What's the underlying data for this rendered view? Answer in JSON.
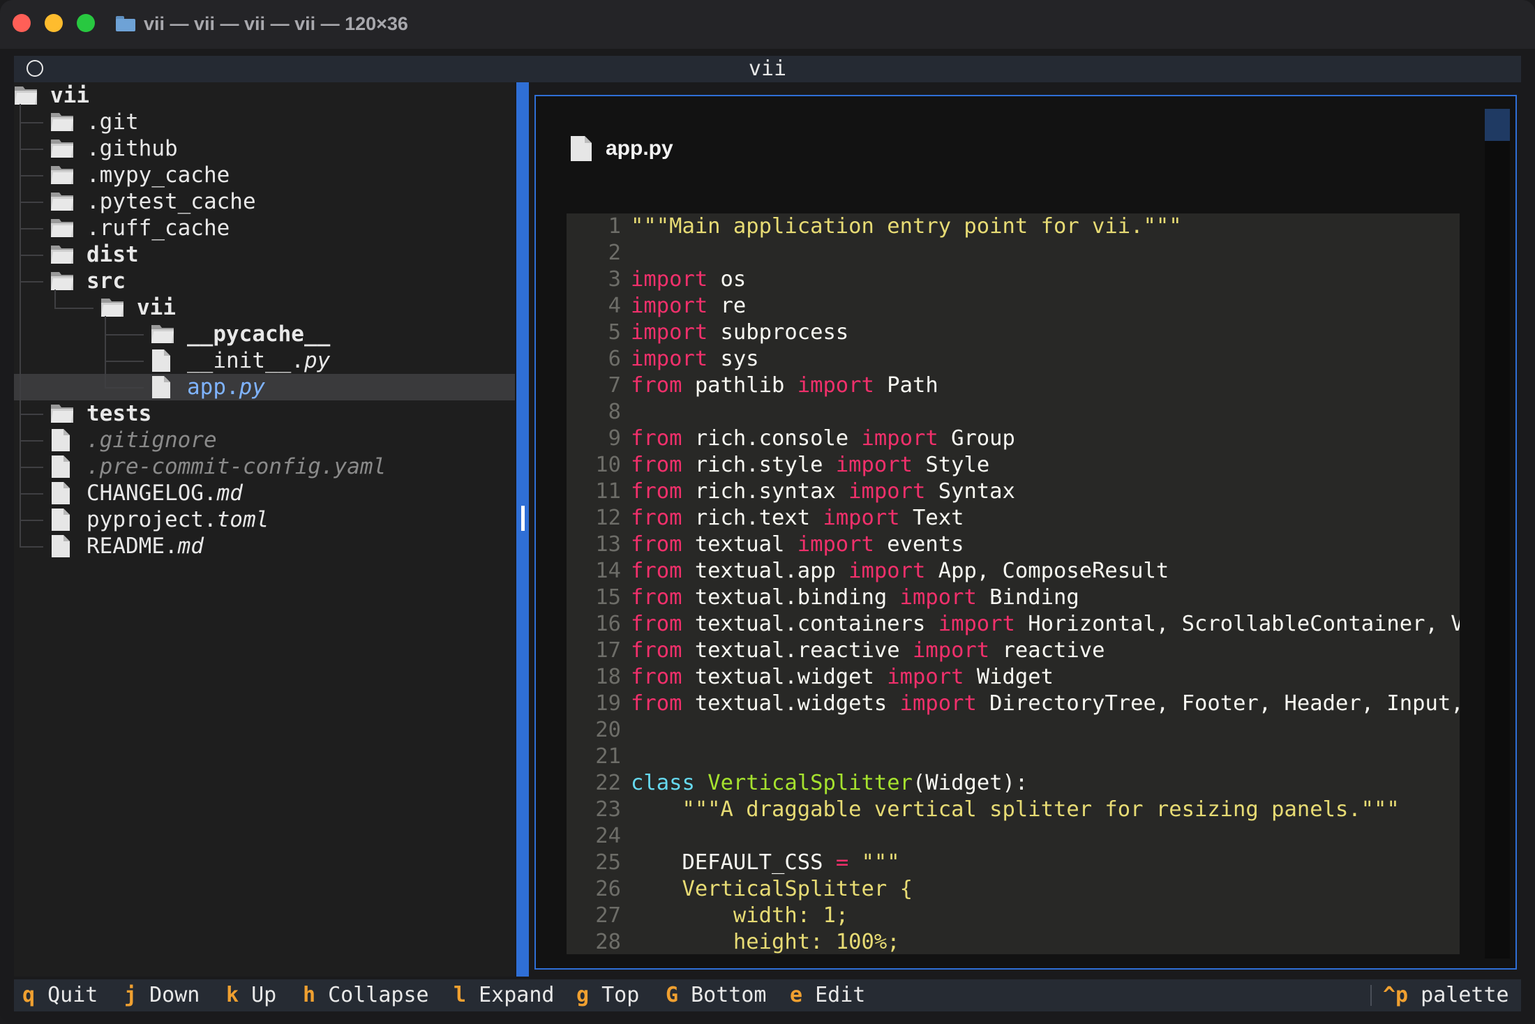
{
  "window": {
    "title": "vii — vii — vii — vii — 120×36"
  },
  "app": {
    "title": "vii"
  },
  "tree": {
    "items": [
      {
        "label": "vii",
        "type": "folder",
        "bold": true
      },
      {
        "label": ".git",
        "type": "folder"
      },
      {
        "label": ".github",
        "type": "folder"
      },
      {
        "label": ".mypy_cache",
        "type": "folder"
      },
      {
        "label": ".pytest_cache",
        "type": "folder"
      },
      {
        "label": ".ruff_cache",
        "type": "folder"
      },
      {
        "label": "dist",
        "type": "folder",
        "bold": true
      },
      {
        "label": "src",
        "type": "folder",
        "bold": true
      },
      {
        "label": "vii",
        "type": "folder",
        "bold": true
      },
      {
        "label": "__pycache__",
        "type": "folder",
        "bold": true
      },
      {
        "stem": "__init__.",
        "ext": "py",
        "type": "file"
      },
      {
        "stem": "app.",
        "ext": "py",
        "type": "file",
        "selected": true
      },
      {
        "label": "tests",
        "type": "folder",
        "bold": true
      },
      {
        "label": ".gitignore",
        "type": "file",
        "dim": true
      },
      {
        "label": ".pre-commit-config.yaml",
        "type": "file",
        "dim": true
      },
      {
        "stem": "CHANGELOG.",
        "ext": "md",
        "type": "file"
      },
      {
        "stem": "pyproject.",
        "ext": "toml",
        "type": "file"
      },
      {
        "stem": "README.",
        "ext": "md",
        "type": "file"
      }
    ]
  },
  "preview": {
    "filename": "app.py",
    "lines": [
      {
        "n": "1",
        "tokens": [
          [
            "s",
            "\"\"\"Main application entry point for vii.\"\"\""
          ]
        ]
      },
      {
        "n": "2",
        "tokens": []
      },
      {
        "n": "3",
        "tokens": [
          [
            "k",
            "import"
          ],
          [
            "t",
            " os"
          ]
        ]
      },
      {
        "n": "4",
        "tokens": [
          [
            "k",
            "import"
          ],
          [
            "t",
            " re"
          ]
        ]
      },
      {
        "n": "5",
        "tokens": [
          [
            "k",
            "import"
          ],
          [
            "t",
            " subprocess"
          ]
        ]
      },
      {
        "n": "6",
        "tokens": [
          [
            "k",
            "import"
          ],
          [
            "t",
            " sys"
          ]
        ]
      },
      {
        "n": "7",
        "tokens": [
          [
            "k",
            "from"
          ],
          [
            "t",
            " pathlib "
          ],
          [
            "k",
            "import"
          ],
          [
            "t",
            " Path"
          ]
        ]
      },
      {
        "n": "8",
        "tokens": []
      },
      {
        "n": "9",
        "tokens": [
          [
            "k",
            "from"
          ],
          [
            "t",
            " rich.console "
          ],
          [
            "k",
            "import"
          ],
          [
            "t",
            " Group"
          ]
        ]
      },
      {
        "n": "10",
        "tokens": [
          [
            "k",
            "from"
          ],
          [
            "t",
            " rich.style "
          ],
          [
            "k",
            "import"
          ],
          [
            "t",
            " Style"
          ]
        ]
      },
      {
        "n": "11",
        "tokens": [
          [
            "k",
            "from"
          ],
          [
            "t",
            " rich.syntax "
          ],
          [
            "k",
            "import"
          ],
          [
            "t",
            " Syntax"
          ]
        ]
      },
      {
        "n": "12",
        "tokens": [
          [
            "k",
            "from"
          ],
          [
            "t",
            " rich.text "
          ],
          [
            "k",
            "import"
          ],
          [
            "t",
            " Text"
          ]
        ]
      },
      {
        "n": "13",
        "tokens": [
          [
            "k",
            "from"
          ],
          [
            "t",
            " textual "
          ],
          [
            "k",
            "import"
          ],
          [
            "t",
            " events"
          ]
        ]
      },
      {
        "n": "14",
        "tokens": [
          [
            "k",
            "from"
          ],
          [
            "t",
            " textual.app "
          ],
          [
            "k",
            "import"
          ],
          [
            "t",
            " App, ComposeResult"
          ]
        ]
      },
      {
        "n": "15",
        "tokens": [
          [
            "k",
            "from"
          ],
          [
            "t",
            " textual.binding "
          ],
          [
            "k",
            "import"
          ],
          [
            "t",
            " Binding"
          ]
        ]
      },
      {
        "n": "16",
        "tokens": [
          [
            "k",
            "from"
          ],
          [
            "t",
            " textual.containers "
          ],
          [
            "k",
            "import"
          ],
          [
            "t",
            " Horizontal, ScrollableContainer, V"
          ]
        ]
      },
      {
        "n": "17",
        "tokens": [
          [
            "k",
            "from"
          ],
          [
            "t",
            " textual.reactive "
          ],
          [
            "k",
            "import"
          ],
          [
            "t",
            " reactive"
          ]
        ]
      },
      {
        "n": "18",
        "tokens": [
          [
            "k",
            "from"
          ],
          [
            "t",
            " textual.widget "
          ],
          [
            "k",
            "import"
          ],
          [
            "t",
            " Widget"
          ]
        ]
      },
      {
        "n": "19",
        "tokens": [
          [
            "k",
            "from"
          ],
          [
            "t",
            " textual.widgets "
          ],
          [
            "k",
            "import"
          ],
          [
            "t",
            " DirectoryTree, Footer, Header, Input,"
          ]
        ]
      },
      {
        "n": "20",
        "tokens": []
      },
      {
        "n": "21",
        "tokens": []
      },
      {
        "n": "22",
        "tokens": [
          [
            "c",
            "class"
          ],
          [
            "t",
            " "
          ],
          [
            "f",
            "VerticalSplitter"
          ],
          [
            "t",
            "(Widget):"
          ]
        ]
      },
      {
        "n": "23",
        "tokens": [
          [
            "t",
            "    "
          ],
          [
            "s",
            "\"\"\"A draggable vertical splitter for resizing panels.\"\"\""
          ]
        ]
      },
      {
        "n": "24",
        "tokens": []
      },
      {
        "n": "25",
        "tokens": [
          [
            "t",
            "    DEFAULT_CSS "
          ],
          [
            "k",
            "="
          ],
          [
            "t",
            " "
          ],
          [
            "s",
            "\"\"\""
          ]
        ]
      },
      {
        "n": "26",
        "tokens": [
          [
            "s",
            "    VerticalSplitter {"
          ]
        ]
      },
      {
        "n": "27",
        "tokens": [
          [
            "s",
            "        width: 1;"
          ]
        ]
      },
      {
        "n": "28",
        "tokens": [
          [
            "s",
            "        height: 100%;"
          ]
        ]
      }
    ]
  },
  "footer": {
    "bindings": [
      {
        "key": "q",
        "label": "Quit"
      },
      {
        "key": "j",
        "label": "Down"
      },
      {
        "key": "k",
        "label": "Up"
      },
      {
        "key": "h",
        "label": "Collapse"
      },
      {
        "key": "l",
        "label": "Expand"
      },
      {
        "key": "g",
        "label": "Top"
      },
      {
        "key": "G",
        "label": "Bottom"
      },
      {
        "key": "e",
        "label": "Edit"
      }
    ],
    "palette_key": "^p",
    "palette_label": "palette"
  }
}
